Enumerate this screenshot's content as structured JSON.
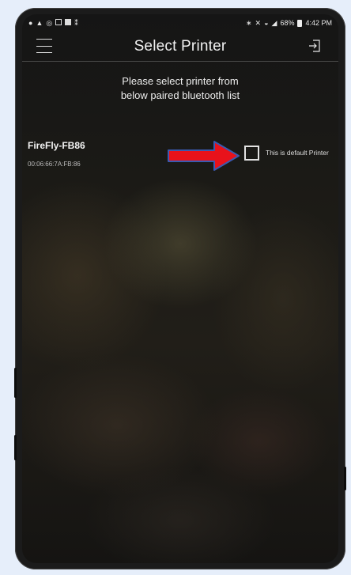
{
  "statusbar": {
    "left_icons": [
      "notification-icon",
      "alert-icon",
      "sync-icon",
      "clipboard-icon",
      "image-icon",
      "usb-icon"
    ],
    "right_icons": [
      "bluetooth-icon",
      "mute-icon",
      "wifi-icon",
      "signal-icon"
    ],
    "battery": "68%",
    "time": "4:42 PM"
  },
  "header": {
    "title": "Select Printer"
  },
  "hint": {
    "line1": "Please select printer from",
    "line2": "below paired bluetooth list"
  },
  "printers": [
    {
      "name": "FireFly-FB86",
      "mac": "00:06:66:7A:FB:86",
      "default_label": "This is default Printer",
      "is_default": false
    }
  ],
  "colors": {
    "annotation_arrow": "#e8121b",
    "annotation_outline": "#3a5ab0"
  }
}
